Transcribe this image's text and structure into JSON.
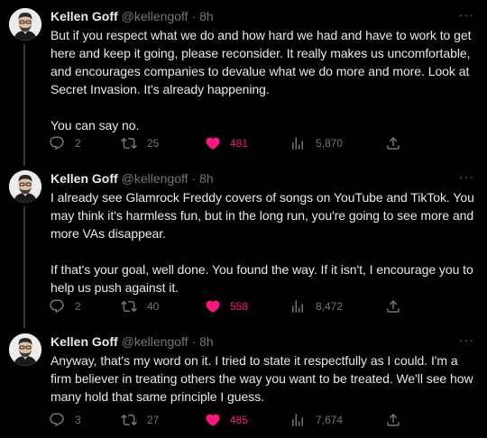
{
  "author": {
    "name": "Kellen Goff",
    "handle": "@kellengoff",
    "time": "· 8h"
  },
  "colors": {
    "background": "#000000",
    "text": "#e7e9ea",
    "muted": "#71767b",
    "like": "#f91880",
    "thread_line": "#333639"
  },
  "tweets": [
    {
      "text": "But if you respect what we do and how hard we had and have to work to get here and keep it going, please reconsider. It really makes us uncomfortable, and encourages companies to devalue what we do more and more. Look at Secret Invasion. It's already happening.\n\nYou can say no.",
      "replies": "2",
      "retweets": "25",
      "likes": "481",
      "views": "5,870"
    },
    {
      "text": "I already see Glamrock Freddy covers of songs on YouTube and TikTok. You may think it's harmless fun, but in the long run, you're going to see more and more VAs disappear.\n\nIf that's your goal, well done. You found the way. If it isn't, I encourage you to help us push against it.",
      "replies": "2",
      "retweets": "40",
      "likes": "558",
      "views": "8,472"
    },
    {
      "text": "Anyway, that's my word on it. I tried to state it respectfully as I could. I'm a firm believer in treating others the way you want to be treated. We'll see how many hold that same principle I guess.",
      "replies": "3",
      "retweets": "27",
      "likes": "485",
      "views": "7,674"
    }
  ],
  "icons": {
    "reply": "reply-icon",
    "retweet": "retweet-icon",
    "like": "heart-icon",
    "views": "views-icon",
    "share": "share-icon",
    "more": "more-icon"
  }
}
